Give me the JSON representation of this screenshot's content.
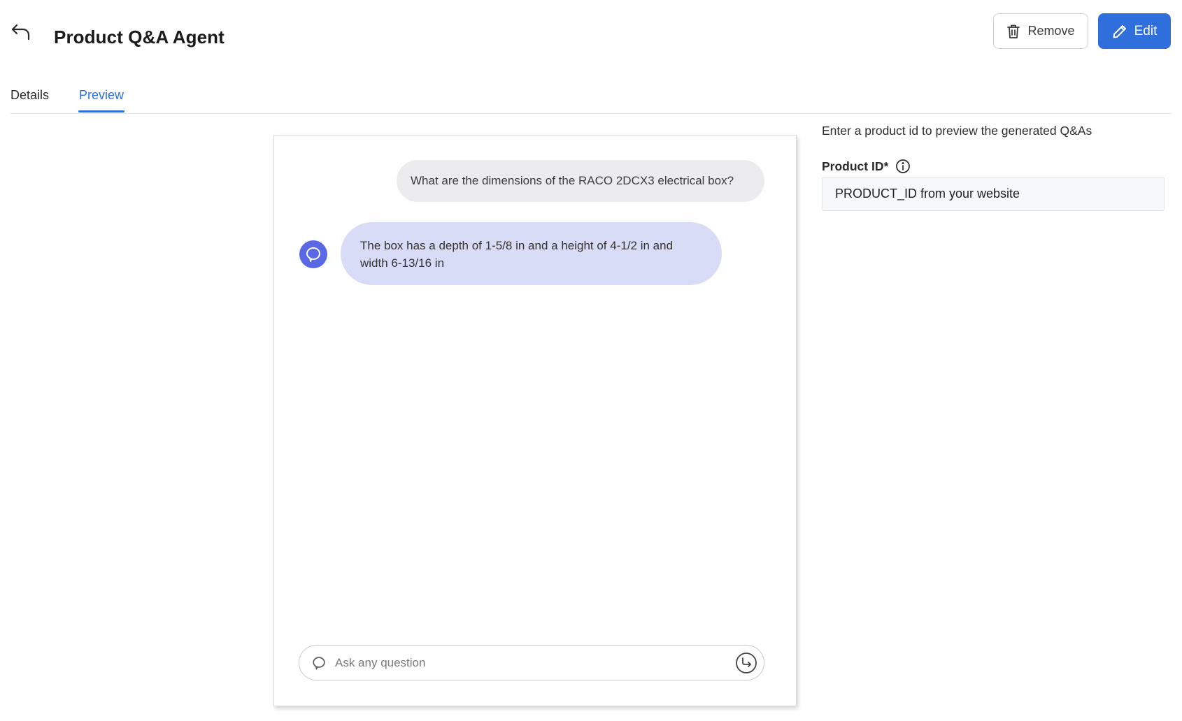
{
  "header": {
    "title": "Product Q&A Agent",
    "back_icon": "back-arrow-icon",
    "remove_label": "Remove",
    "remove_icon": "trash-icon",
    "edit_label": "Edit",
    "edit_icon": "pencil-icon"
  },
  "tabs": [
    {
      "label": "Details",
      "active": false
    },
    {
      "label": "Preview",
      "active": true
    }
  ],
  "chat": {
    "messages": [
      {
        "role": "user",
        "text": "What are the dimensions of the RACO 2DCX3 electrical box?"
      },
      {
        "role": "agent",
        "text": "The box has a depth of 1-5/8 in and a height of 4-1/2 in and width 6-13/16 in"
      }
    ],
    "input": {
      "value": "",
      "placeholder": "Ask any question"
    }
  },
  "preview_form": {
    "hint": "Enter a product id to preview the generated Q&As",
    "product_id_label": "Product ID*",
    "product_id_value": "",
    "product_id_placeholder": "PRODUCT_ID from your website"
  },
  "colors": {
    "accent": "#2f6fdb",
    "agent_bubble": "#d9dcf7",
    "agent_avatar": "#5a68e6",
    "user_bubble": "#ececee"
  }
}
